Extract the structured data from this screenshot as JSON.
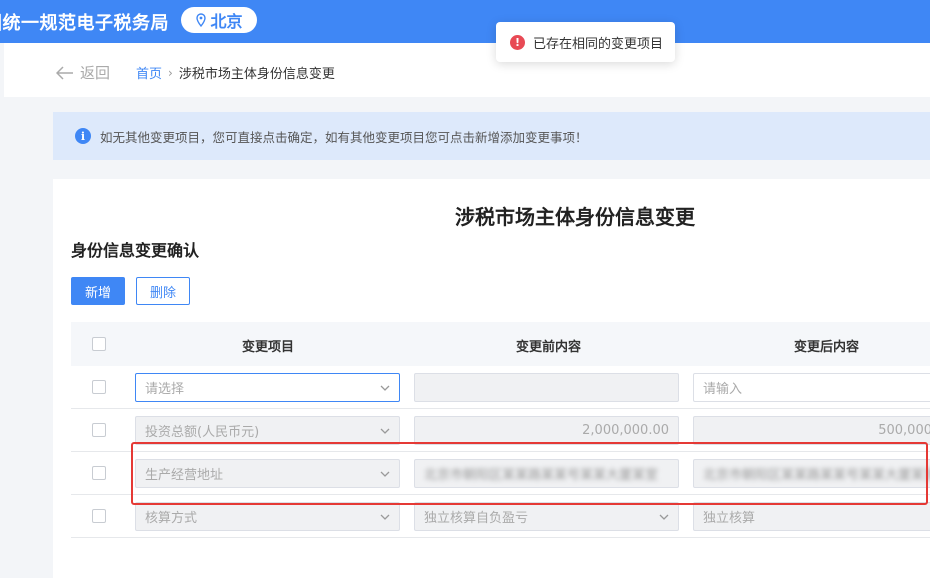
{
  "header": {
    "title": "国统一规范电子税务局",
    "location": "北京"
  },
  "breadcrumb": {
    "back_label": "返回",
    "home": "首页",
    "separator": "›",
    "current": "涉税市场主体身份信息变更"
  },
  "toast": {
    "message": "已存在相同的变更项目"
  },
  "notice": {
    "text": "如无其他变更项目，您可直接点击确定，如有其他变更项目您可点击新增添加变更事项！"
  },
  "card": {
    "title": "涉税市场主体身份信息变更",
    "section_title": "身份信息变更确认",
    "add_label": "新增",
    "delete_label": "删除"
  },
  "table": {
    "headers": {
      "item": "变更项目",
      "before": "变更前内容",
      "after": "变更后内容"
    },
    "rows": [
      {
        "item": "请选择",
        "before": "",
        "after": "请输入"
      },
      {
        "item": "投资总额(人民币元)",
        "before": "2,000,000.00",
        "after": "500,000"
      },
      {
        "item": "生产经营地址",
        "before": "北京市朝阳区某某路某某号某某大厦某室",
        "after": "北京市朝阳区某某路某某号某某大厦某室"
      },
      {
        "item": "核算方式",
        "before": "独立核算自负盈亏",
        "after": "独立核算"
      }
    ]
  },
  "colors": {
    "primary": "#3f87f5",
    "error": "#e84a55",
    "highlight": "#e53935"
  }
}
